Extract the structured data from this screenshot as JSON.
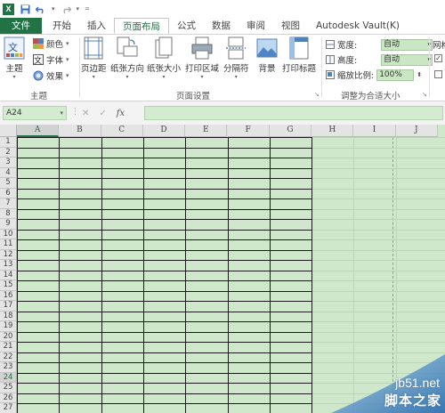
{
  "quick_access": {
    "app_icon": "excel-logo",
    "save_icon": "save-icon",
    "undo_icon": "undo-icon",
    "redo_icon": "redo-icon",
    "customize_icon": "customize-icon"
  },
  "tabs": [
    {
      "label": "文件"
    },
    {
      "label": "开始"
    },
    {
      "label": "插入"
    },
    {
      "label": "页面布局"
    },
    {
      "label": "公式"
    },
    {
      "label": "数据"
    },
    {
      "label": "审阅"
    },
    {
      "label": "视图"
    },
    {
      "label": "Autodesk Vault(K)"
    }
  ],
  "ribbon": {
    "themes": {
      "group_label": "主题",
      "theme_button": "主题",
      "colors": "颜色",
      "fonts": "字体",
      "effects": "效果"
    },
    "page_setup": {
      "group_label": "页面设置",
      "margins": "页边距",
      "orientation": "纸张方向",
      "size": "纸张大小",
      "print_area": "打印区域",
      "breaks": "分隔符",
      "background": "背景",
      "print_titles": "打印标题"
    },
    "scale_to_fit": {
      "group_label": "调整为合适大小",
      "width_label": "宽度:",
      "width_value": "自动",
      "height_label": "高度:",
      "height_value": "自动",
      "scale_label": "缩放比例:",
      "scale_value": "100%"
    },
    "sheet_options": {
      "label": "网格"
    }
  },
  "formula_bar": {
    "name_box": "A24",
    "fx": "fx",
    "formula": ""
  },
  "sheet": {
    "columns": [
      "A",
      "B",
      "C",
      "D",
      "E",
      "F",
      "G",
      "H",
      "I",
      "J"
    ],
    "selected_column": "A",
    "rows": [
      "1",
      "2",
      "3",
      "4",
      "5",
      "6",
      "7",
      "8",
      "9",
      "10",
      "11",
      "12",
      "13",
      "14",
      "15",
      "16",
      "17",
      "18",
      "19",
      "20",
      "21",
      "22",
      "23",
      "24",
      "25",
      "26",
      "27"
    ],
    "selected_row": "24"
  },
  "watermark": {
    "site": "jb51.net",
    "name": "脚本之家"
  },
  "colors": {
    "accent": "#217346",
    "sheet_bg": "#cfe8cc"
  }
}
